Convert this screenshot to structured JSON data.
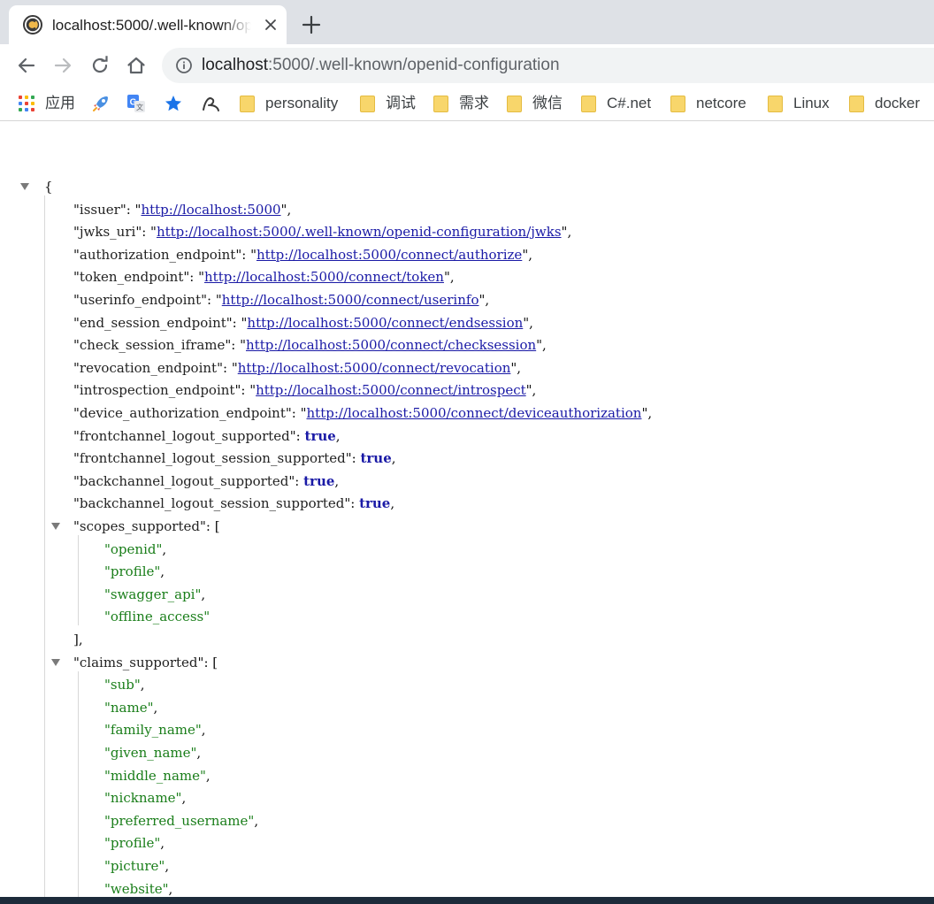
{
  "tab": {
    "title": "localhost:5000/.well-known/openid-configuration"
  },
  "omnibox": {
    "host": "localhost",
    "rest": ":5000/.well-known/openid-configuration"
  },
  "bookmarks": [
    {
      "label": "应用",
      "icon": "apps-grid-icon"
    },
    {
      "label": "",
      "icon": "rocket-icon"
    },
    {
      "label": "",
      "icon": "translate-icon"
    },
    {
      "label": "",
      "icon": "star-icon"
    },
    {
      "label": "",
      "icon": "script-icon"
    },
    {
      "label": "personality",
      "icon": "folder-icon"
    },
    {
      "label": "调试",
      "icon": "folder-icon"
    },
    {
      "label": "需求",
      "icon": "folder-icon"
    },
    {
      "label": "微信",
      "icon": "folder-icon"
    },
    {
      "label": "C#.net",
      "icon": "folder-icon"
    },
    {
      "label": "netcore",
      "icon": "folder-icon"
    },
    {
      "label": "Linux",
      "icon": "folder-icon"
    },
    {
      "label": "docker",
      "icon": "folder-icon"
    }
  ],
  "json": {
    "open_brace": "{",
    "entries": [
      {
        "key": "issuer",
        "value": "http://localhost:5000",
        "type": "link"
      },
      {
        "key": "jwks_uri",
        "value": "http://localhost:5000/.well-known/openid-configuration/jwks",
        "type": "link"
      },
      {
        "key": "authorization_endpoint",
        "value": "http://localhost:5000/connect/authorize",
        "type": "link"
      },
      {
        "key": "token_endpoint",
        "value": "http://localhost:5000/connect/token",
        "type": "link"
      },
      {
        "key": "userinfo_endpoint",
        "value": "http://localhost:5000/connect/userinfo",
        "type": "link"
      },
      {
        "key": "end_session_endpoint",
        "value": "http://localhost:5000/connect/endsession",
        "type": "link"
      },
      {
        "key": "check_session_iframe",
        "value": "http://localhost:5000/connect/checksession",
        "type": "link"
      },
      {
        "key": "revocation_endpoint",
        "value": "http://localhost:5000/connect/revocation",
        "type": "link"
      },
      {
        "key": "introspection_endpoint",
        "value": "http://localhost:5000/connect/introspect",
        "type": "link"
      },
      {
        "key": "device_authorization_endpoint",
        "value": "http://localhost:5000/connect/deviceauthorization",
        "type": "link"
      },
      {
        "key": "frontchannel_logout_supported",
        "value": "true",
        "type": "bool"
      },
      {
        "key": "frontchannel_logout_session_supported",
        "value": "true",
        "type": "bool"
      },
      {
        "key": "backchannel_logout_supported",
        "value": "true",
        "type": "bool"
      },
      {
        "key": "backchannel_logout_session_supported",
        "value": "true",
        "type": "bool"
      }
    ],
    "scopes_key": "scopes_supported",
    "scopes": [
      "openid",
      "profile",
      "swagger_api",
      "offline_access"
    ],
    "claims_key": "claims_supported",
    "claims": [
      "sub",
      "name",
      "family_name",
      "given_name",
      "middle_name",
      "nickname",
      "preferred_username",
      "profile",
      "picture",
      "website"
    ]
  }
}
